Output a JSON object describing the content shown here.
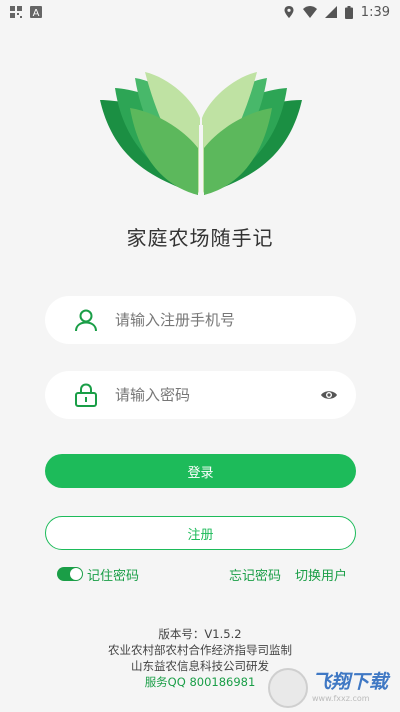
{
  "status_bar": {
    "time": "1:39",
    "left_icons": [
      "qr-notification-icon",
      "a-notification-icon"
    ],
    "right_icons": [
      "location-icon",
      "wifi-icon",
      "signal-icon",
      "battery-icon"
    ]
  },
  "app": {
    "title": "家庭农场随手记",
    "brand_color": "#1dbb5a"
  },
  "form": {
    "phone_placeholder": "请输入注册手机号",
    "phone_value": "",
    "password_placeholder": "请输入密码",
    "password_value": ""
  },
  "buttons": {
    "login": "登录",
    "register": "注册"
  },
  "options": {
    "remember_label": "记住密码",
    "remember_checked": true,
    "forgot_password": "忘记密码",
    "switch_user": "切换用户"
  },
  "footer": {
    "version": "版本号：V1.5.2",
    "supervisor": "农业农村部农村合作经济指导司监制",
    "developer": "山东益农信息科技公司研发",
    "service": "服务QQ 800186981"
  },
  "watermark": {
    "title": "飞翔下载",
    "site": "www.fxxz.com"
  }
}
